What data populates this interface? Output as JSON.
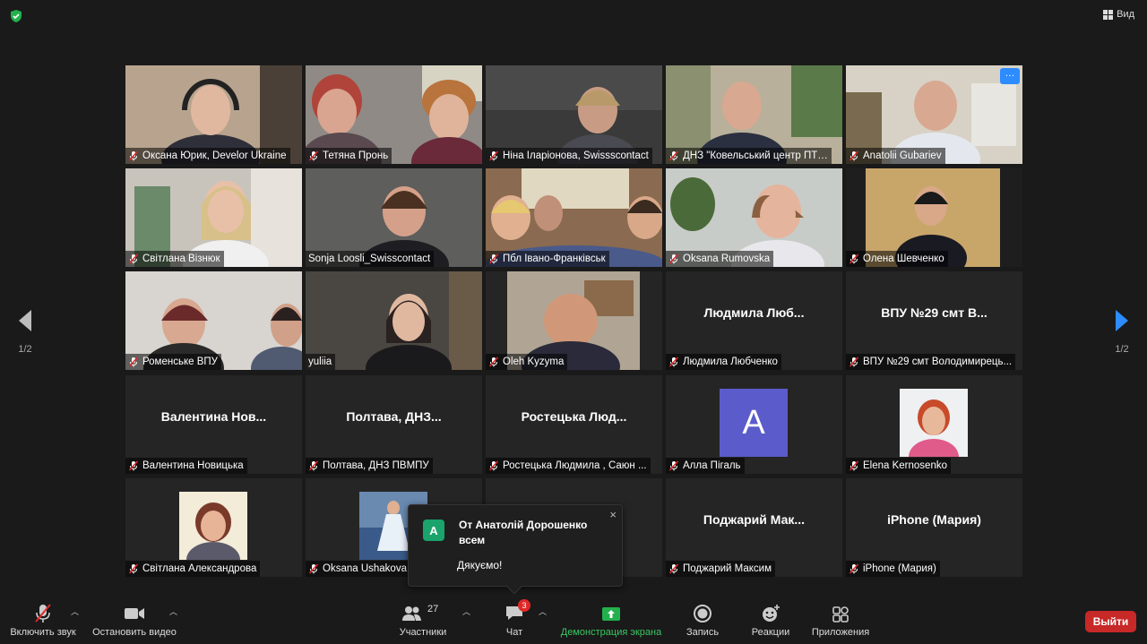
{
  "view": {
    "label": "Вид"
  },
  "pagination": {
    "left": "1/2",
    "right": "1/2"
  },
  "participants": [
    {
      "label": "Оксана Юрик, Develor Ukraine",
      "muted": true,
      "video": true
    },
    {
      "label": "Тетяна Пронь",
      "muted": true,
      "video": true
    },
    {
      "label": "Ніна Іларіонова, Swissscontact",
      "muted": true,
      "video": true
    },
    {
      "label": "ДНЗ \"Ковельський центр ПТ…",
      "muted": true,
      "video": true
    },
    {
      "label": "Anatolii Gubariev",
      "muted": true,
      "video": true
    },
    {
      "label": "Світлана Візнюк",
      "muted": true,
      "video": true
    },
    {
      "label": "Sonja Loosli_Swisscontact",
      "muted": false,
      "video": true
    },
    {
      "label": "Пбл Івано-Франківськ",
      "muted": true,
      "video": true
    },
    {
      "label": "Oksana Rumovska",
      "muted": true,
      "video": true
    },
    {
      "label": "Олена Шевченко",
      "muted": true,
      "video": true
    },
    {
      "label": "Роменське ВПУ",
      "muted": true,
      "video": true
    },
    {
      "label": "yuliia",
      "muted": false,
      "video": true
    },
    {
      "label": "Oleh Kyzyma",
      "muted": true,
      "video": true
    },
    {
      "label": "Людмила Любченко",
      "bigname": "Людмила Люб...",
      "muted": true,
      "video": false
    },
    {
      "label": "ВПУ №29 смт Володимирець...",
      "bigname": "ВПУ №29 смт В...",
      "muted": true,
      "video": false
    },
    {
      "label": "Валентина Новицька",
      "bigname": "Валентина Нов...",
      "muted": true,
      "video": false
    },
    {
      "label": "Полтава, ДНЗ ПВМПУ",
      "bigname": "Полтава, ДНЗ...",
      "muted": true,
      "video": false
    },
    {
      "label": "Ростецька Людмила , Саюн ...",
      "bigname": "Ростецька Люд...",
      "muted": true,
      "video": false
    },
    {
      "label": "Алла Пігаль",
      "avatar_letter": "A",
      "muted": true,
      "video": false
    },
    {
      "label": "Elena Kernosenko",
      "muted": true,
      "video": false
    },
    {
      "label": "Світлана Александрова",
      "muted": true,
      "video": false
    },
    {
      "label": "Oksana Ushakova",
      "muted": true,
      "video": false
    },
    {
      "label": "",
      "muted": false,
      "video": false
    },
    {
      "label": "Поджарий Максим",
      "bigname": "Поджарий Мак...",
      "muted": true,
      "video": false
    },
    {
      "label": "iPhone (Мария)",
      "bigname": "iPhone (Мария)",
      "muted": true,
      "video": false
    }
  ],
  "chat_popup": {
    "avatar": "A",
    "from": "От Анатолій Дорошенко всем",
    "message": "Дякуємо!",
    "close": "×"
  },
  "toolbar": {
    "audio": "Включить звук",
    "video": "Остановить видео",
    "participants": "Участники",
    "participants_count": "27",
    "chat": "Чат",
    "chat_badge": "3",
    "share": "Демонстрация экрана",
    "record": "Запись",
    "reactions": "Реакции",
    "apps": "Приложения",
    "leave": "Выйти"
  },
  "colors": {
    "accent": "#2d8cff",
    "share": "#39c860",
    "leave": "#c72828",
    "active_speaker": "#d6e07a"
  }
}
